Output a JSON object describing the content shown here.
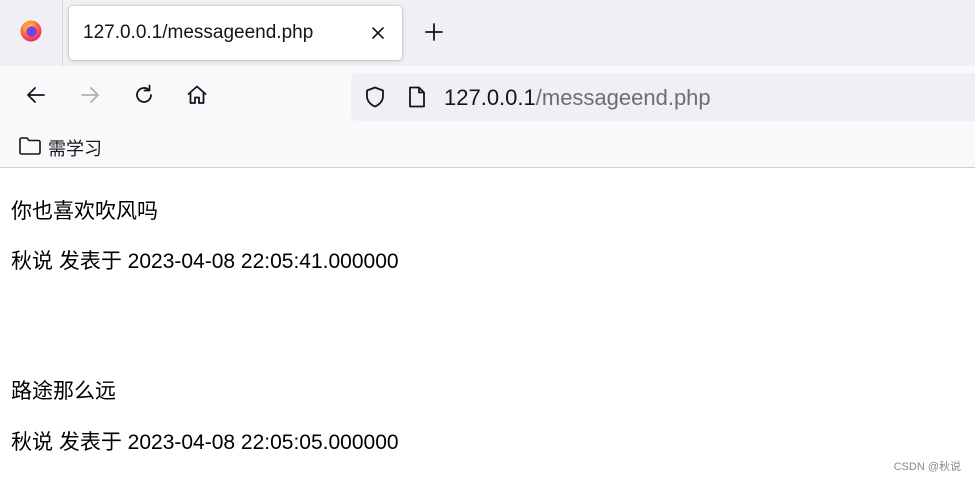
{
  "browser": {
    "tab": {
      "title": "127.0.0.1/messageend.php"
    },
    "url": {
      "host": "127.0.0.1",
      "path": "/messageend.php"
    },
    "bookmarks": [
      {
        "label": "需学习",
        "icon": "folder-icon"
      }
    ],
    "accent_color": "#ff7139"
  },
  "messages": [
    {
      "content": "你也喜欢吹风吗",
      "meta": "秋说 发表于 2023-04-08 22:05:41.000000"
    },
    {
      "content": "路途那么远",
      "meta": "秋说 发表于 2023-04-08 22:05:05.000000"
    }
  ],
  "watermark": "CSDN @秋说"
}
